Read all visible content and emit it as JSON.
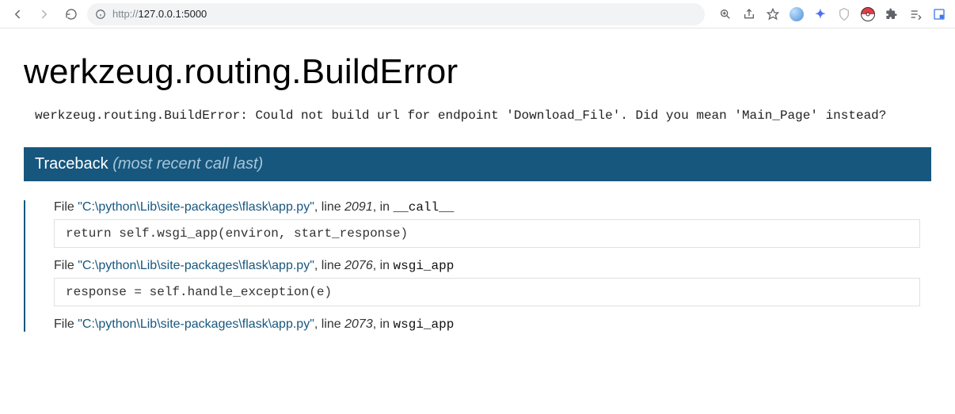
{
  "browser": {
    "url_scheme": "http://",
    "url_rest": "127.0.0.1:5000",
    "icons": {
      "back": "back-icon",
      "forward": "forward-icon",
      "reload": "reload-icon",
      "site_info": "info-icon",
      "zoom": "magnify-icon",
      "share": "share-icon",
      "bookmark": "star-icon",
      "extensions": "puzzle-icon",
      "reading_list": "reading-list-icon",
      "devtools": "devtools-icon"
    }
  },
  "error": {
    "title": "werkzeug.routing.BuildError",
    "message": "werkzeug.routing.BuildError: Could not build url for endpoint 'Download_File'. Did you mean 'Main_Page' instead?"
  },
  "traceback": {
    "header": "Traceback",
    "subheader": "(most recent call last)",
    "frames": [
      {
        "file_label": "File",
        "path": "\"C:\\python\\Lib\\site-packages\\flask\\app.py\"",
        "line_label": ", line ",
        "line": "2091",
        "in_label": ", in ",
        "func": "__call__",
        "code": "return self.wsgi_app(environ, start_response)"
      },
      {
        "file_label": "File",
        "path": "\"C:\\python\\Lib\\site-packages\\flask\\app.py\"",
        "line_label": ", line ",
        "line": "2076",
        "in_label": ", in ",
        "func": "wsgi_app",
        "code": "response = self.handle_exception(e)"
      },
      {
        "file_label": "File",
        "path": "\"C:\\python\\Lib\\site-packages\\flask\\app.py\"",
        "line_label": ", line ",
        "line": "2073",
        "in_label": ", in ",
        "func": "wsgi_app",
        "code": ""
      }
    ]
  }
}
